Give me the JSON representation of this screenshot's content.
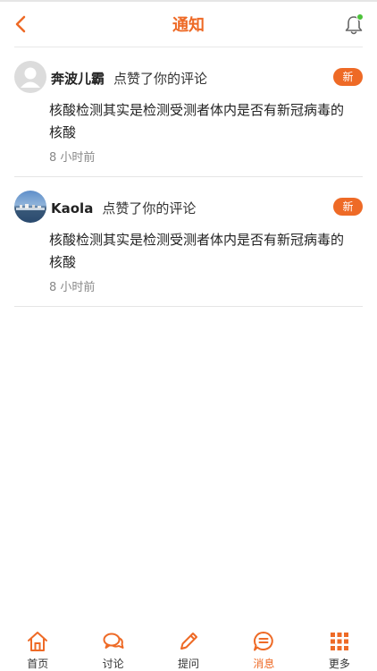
{
  "header": {
    "title": "通知",
    "accent": "#ee6a26"
  },
  "notifications": [
    {
      "user": "奔波儿霸",
      "action": "点赞了你的评论",
      "badge": "新",
      "content": "核酸检测其实是检测受测者体内是否有新冠病毒的核酸",
      "time": "8 小时前",
      "avatar": "default-avatar"
    },
    {
      "user": "Kaola",
      "action": "点赞了你的评论",
      "badge": "新",
      "content": "核酸检测其实是检测受测者体内是否有新冠病毒的核酸",
      "time": "8 小时前",
      "avatar": "photo-avatar"
    }
  ],
  "tabbar": {
    "items": [
      {
        "label": "首页",
        "icon": "home-icon"
      },
      {
        "label": "讨论",
        "icon": "chat-icon"
      },
      {
        "label": "提问",
        "icon": "pencil-icon"
      },
      {
        "label": "消息",
        "icon": "message-icon",
        "active": true
      },
      {
        "label": "更多",
        "icon": "grid-icon"
      }
    ]
  }
}
